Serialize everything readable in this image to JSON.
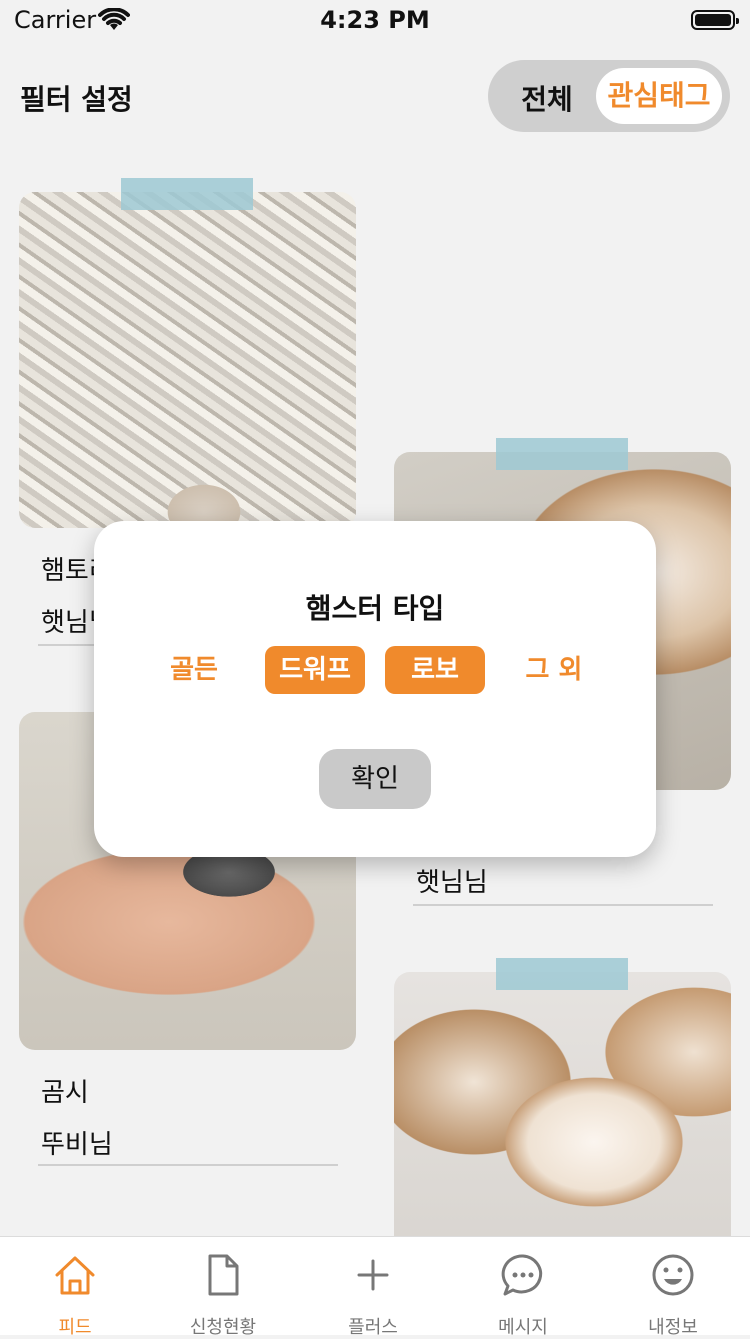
{
  "status_bar": {
    "carrier": "Carrier",
    "time": "4:23 PM"
  },
  "header": {
    "title": "필터 설정",
    "toggle": {
      "all_label": "전체",
      "selected_label": "관심태그"
    }
  },
  "cards": [
    {
      "title": "햄토리",
      "author": "햇님님"
    },
    {
      "title": "",
      "author": "햇님님"
    },
    {
      "title": "곰시",
      "author": "뚜비님"
    }
  ],
  "modal": {
    "title": "햄스터 타입",
    "options": [
      {
        "label": "골든",
        "selected": false
      },
      {
        "label": "드워프",
        "selected": true
      },
      {
        "label": "로보",
        "selected": true
      },
      {
        "label": "그 외",
        "selected": false
      }
    ],
    "confirm_label": "확인"
  },
  "tab_bar": {
    "items": [
      {
        "label": "피드",
        "icon": "home-icon",
        "active": true
      },
      {
        "label": "신청현황",
        "icon": "document-icon",
        "active": false
      },
      {
        "label": "플러스",
        "icon": "plus-icon",
        "active": false
      },
      {
        "label": "메시지",
        "icon": "chat-bubble-icon",
        "active": false
      },
      {
        "label": "내정보",
        "icon": "smiley-icon",
        "active": false
      }
    ]
  },
  "colors": {
    "accent": "#f08a2c",
    "tape": "#9ec9d4",
    "toggle_bg": "#cfcfcf",
    "button_gray": "#c9c9c9"
  }
}
